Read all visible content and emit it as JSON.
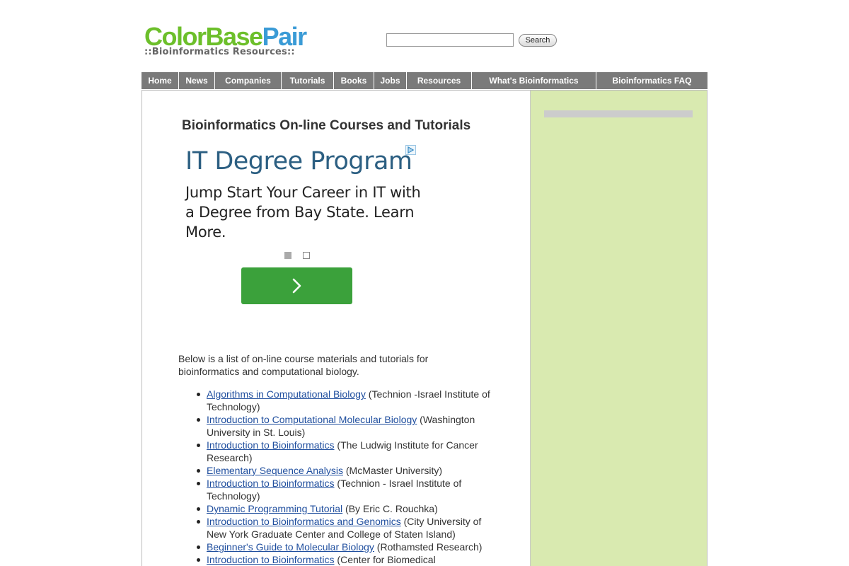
{
  "header": {
    "logo_part1": "ColorBase",
    "logo_part2": "Pair",
    "tagline": "::Bioinformatics Resources::",
    "search_value": "",
    "search_button": "Search"
  },
  "nav": {
    "items": [
      "Home",
      "News",
      "Companies",
      "Tutorials",
      "Books",
      "Jobs",
      "Resources",
      "What's Bioinformatics",
      "Bioinformatics FAQ"
    ]
  },
  "main": {
    "title": "Bioinformatics On-line Courses and Tutorials",
    "intro": "Below is a list of on-line course materials and tutorials for bioinformatics and computational biology.",
    "courses": [
      {
        "link": "Algorithms in Computational Biology",
        "source": " (Technion -Israel Institute of Technology)"
      },
      {
        "link": "Introduction to Computational Molecular Biology",
        "source": " (Washington University in St. Louis)"
      },
      {
        "link": "Introduction to Bioinformatics",
        "source": " (The Ludwig Institute for Cancer Research)"
      },
      {
        "link": "Elementary Sequence Analysis",
        "source": " (McMaster University)"
      },
      {
        "link": "Introduction to Bioinformatics",
        "source": " (Technion - Israel Institute of Technology)"
      },
      {
        "link": "Dynamic Programming Tutorial",
        "source": " (By Eric C. Rouchka)"
      },
      {
        "link": "Introduction to Bioinformatics and Genomics",
        "source": " (City University of New York Graduate Center and College of Staten Island)"
      },
      {
        "link": "Beginner's Guide to Molecular Biology",
        "source": " (Rothamsted Research)"
      },
      {
        "link": "Introduction to Bioinformatics",
        "source": " (Center for Biomedical"
      }
    ]
  },
  "ad": {
    "title": "IT Degree Program",
    "body": "Jump Start Your Career in IT with a Degree from Bay State. Learn More.",
    "choice_icon": "adchoices-icon",
    "next_icon": "chevron-right-icon"
  },
  "colors": {
    "logo_green": "#6cbf2a",
    "logo_blue": "#3a9bd6",
    "nav_bg": "#7a7a7a",
    "sidebar_bg": "#d9eab0",
    "ad_button": "#3ba13b",
    "link": "#1f4e9e"
  }
}
